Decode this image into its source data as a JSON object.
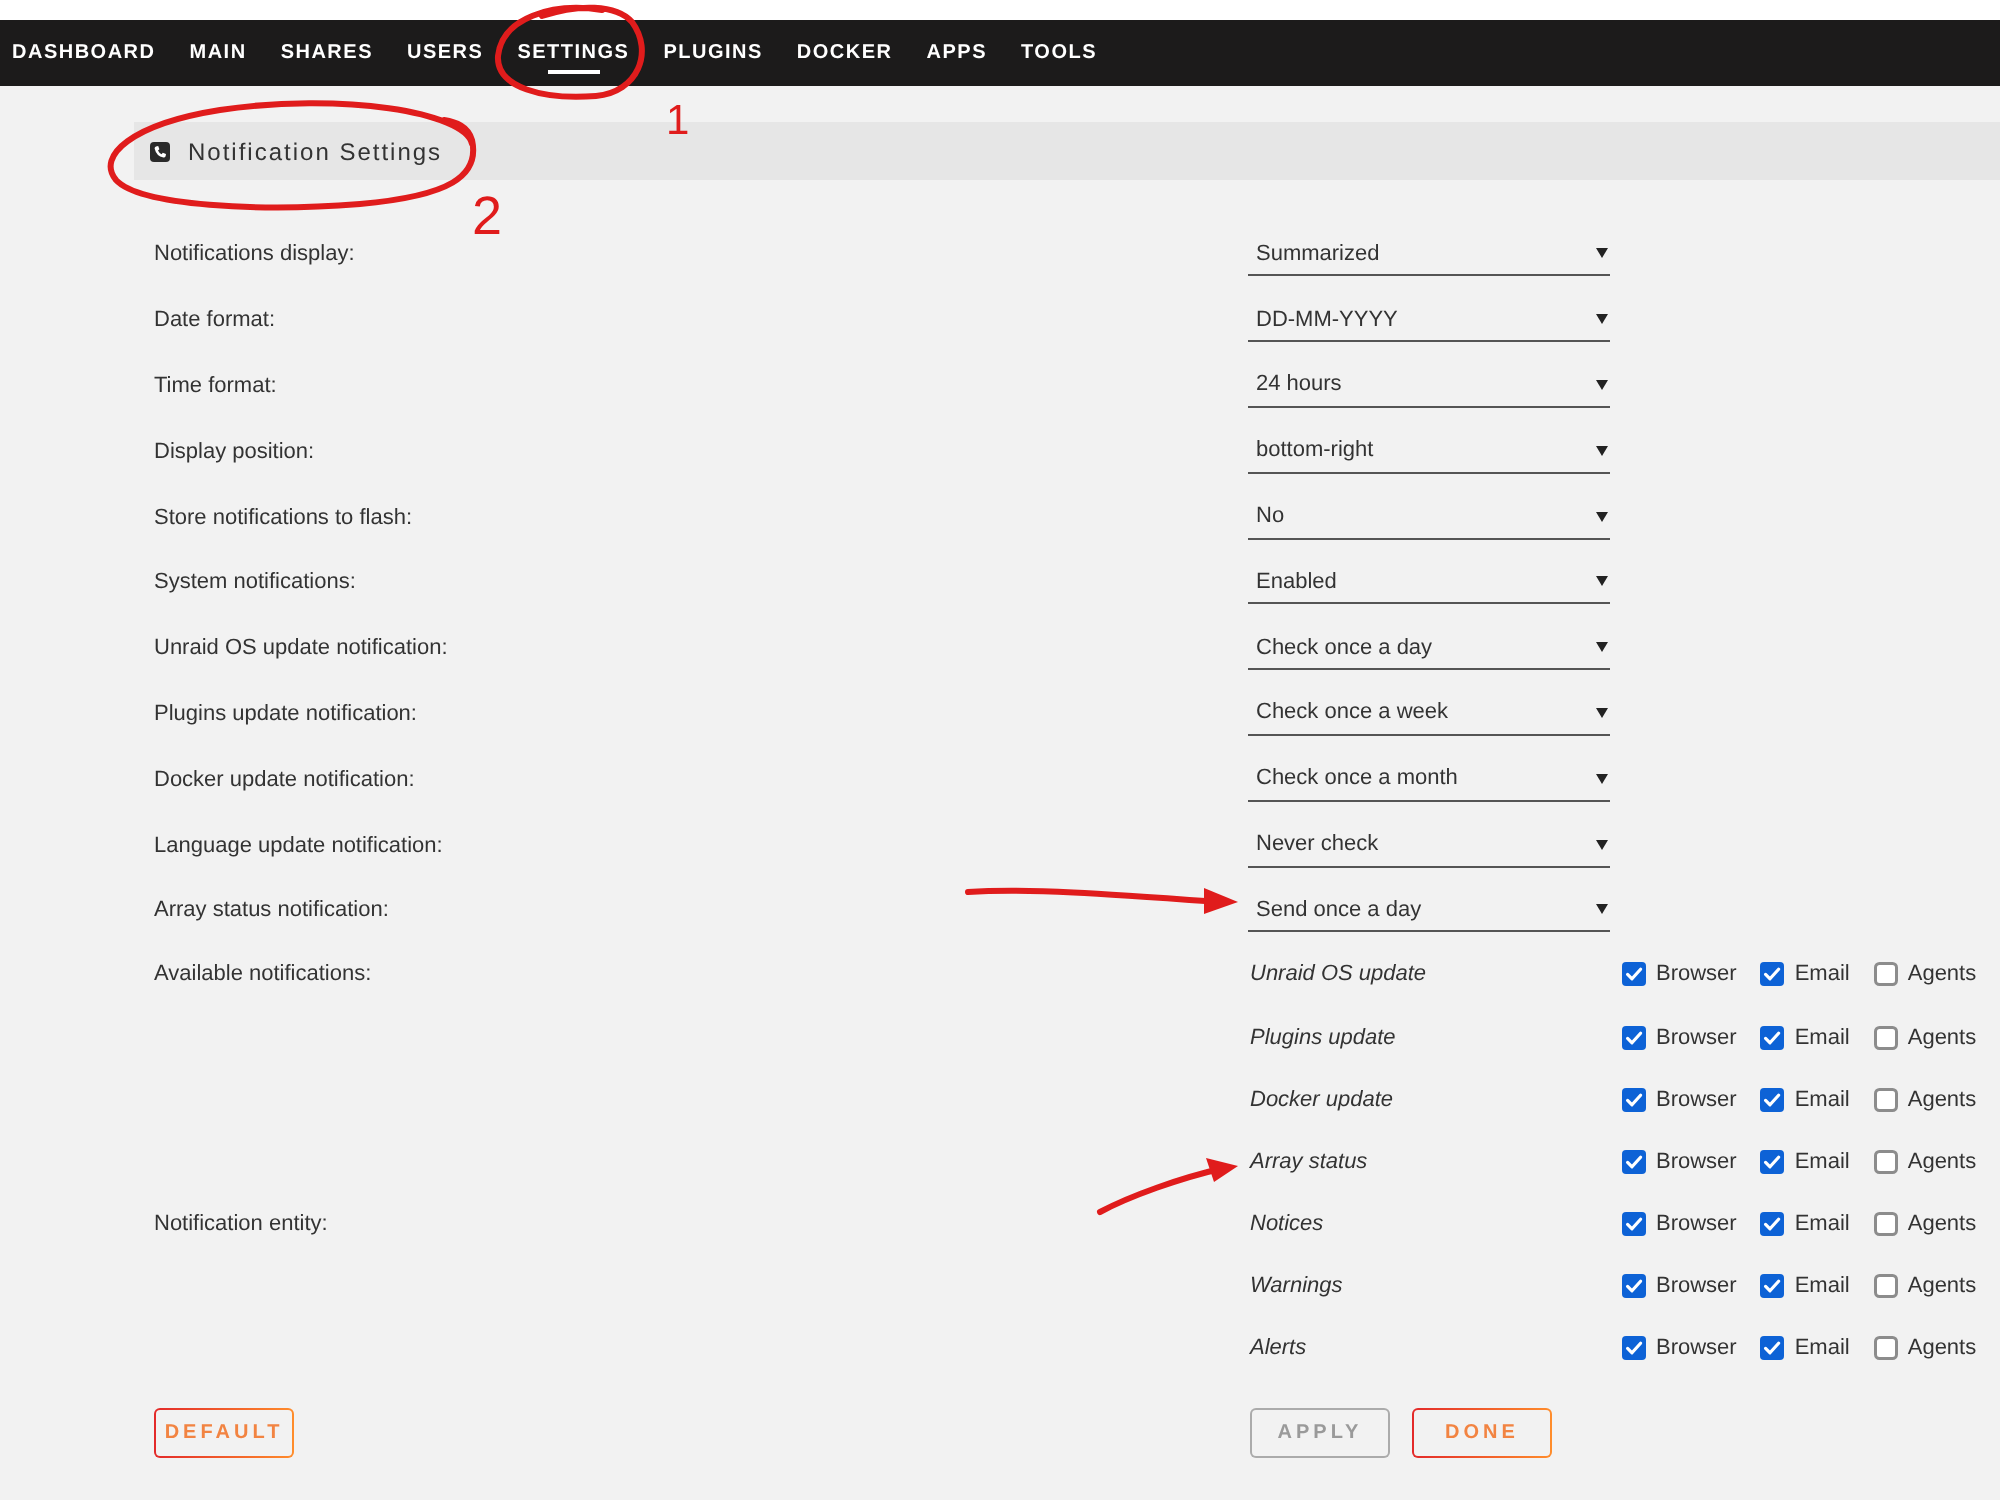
{
  "nav": [
    {
      "label": "DASHBOARD",
      "selected": false
    },
    {
      "label": "MAIN",
      "selected": false
    },
    {
      "label": "SHARES",
      "selected": false
    },
    {
      "label": "USERS",
      "selected": false
    },
    {
      "label": "SETTINGS",
      "selected": true
    },
    {
      "label": "PLUGINS",
      "selected": false
    },
    {
      "label": "DOCKER",
      "selected": false
    },
    {
      "label": "APPS",
      "selected": false
    },
    {
      "label": "TOOLS",
      "selected": false
    }
  ],
  "section": {
    "title": "Notification Settings"
  },
  "settings": [
    {
      "label": "Notifications display:",
      "value": "Summarized"
    },
    {
      "label": "Date format:",
      "value": "DD-MM-YYYY"
    },
    {
      "label": "Time format:",
      "value": "24 hours"
    },
    {
      "label": "Display position:",
      "value": "bottom-right"
    },
    {
      "label": "Store notifications to flash:",
      "value": "No"
    },
    {
      "label": "System notifications:",
      "value": "Enabled"
    },
    {
      "label": "Unraid OS update notification:",
      "value": "Check once a day"
    },
    {
      "label": "Plugins update notification:",
      "value": "Check once a week"
    },
    {
      "label": "Docker update notification:",
      "value": "Check once a month"
    },
    {
      "label": "Language update notification:",
      "value": "Never check"
    },
    {
      "label": "Array status notification:",
      "value": "Send once a day"
    }
  ],
  "notification_groups": [
    {
      "label": "Available notifications:",
      "rows": [
        {
          "name": "Unraid OS update",
          "options": [
            {
              "label": "Browser",
              "checked": true
            },
            {
              "label": "Email",
              "checked": true
            },
            {
              "label": "Agents",
              "checked": false
            }
          ]
        },
        {
          "name": "Plugins update",
          "options": [
            {
              "label": "Browser",
              "checked": true
            },
            {
              "label": "Email",
              "checked": true
            },
            {
              "label": "Agents",
              "checked": false
            }
          ]
        },
        {
          "name": "Docker update",
          "options": [
            {
              "label": "Browser",
              "checked": true
            },
            {
              "label": "Email",
              "checked": true
            },
            {
              "label": "Agents",
              "checked": false
            }
          ]
        },
        {
          "name": "Array status",
          "options": [
            {
              "label": "Browser",
              "checked": true
            },
            {
              "label": "Email",
              "checked": true
            },
            {
              "label": "Agents",
              "checked": false
            }
          ]
        }
      ]
    },
    {
      "label": "Notification entity:",
      "rows": [
        {
          "name": "Notices",
          "options": [
            {
              "label": "Browser",
              "checked": true
            },
            {
              "label": "Email",
              "checked": true
            },
            {
              "label": "Agents",
              "checked": false
            }
          ]
        },
        {
          "name": "Warnings",
          "options": [
            {
              "label": "Browser",
              "checked": true
            },
            {
              "label": "Email",
              "checked": true
            },
            {
              "label": "Agents",
              "checked": false
            }
          ]
        },
        {
          "name": "Alerts",
          "options": [
            {
              "label": "Browser",
              "checked": true
            },
            {
              "label": "Email",
              "checked": true
            },
            {
              "label": "Agents",
              "checked": false
            }
          ]
        }
      ]
    }
  ],
  "buttons": [
    {
      "label": "DEFAULT",
      "disabled": false
    },
    {
      "label": "APPLY",
      "disabled": true
    },
    {
      "label": "DONE",
      "disabled": false
    }
  ],
  "annotations": [
    {
      "kind": "circle",
      "label": "1"
    },
    {
      "kind": "circle",
      "label": "2"
    },
    {
      "kind": "arrow"
    },
    {
      "kind": "arrow"
    }
  ]
}
